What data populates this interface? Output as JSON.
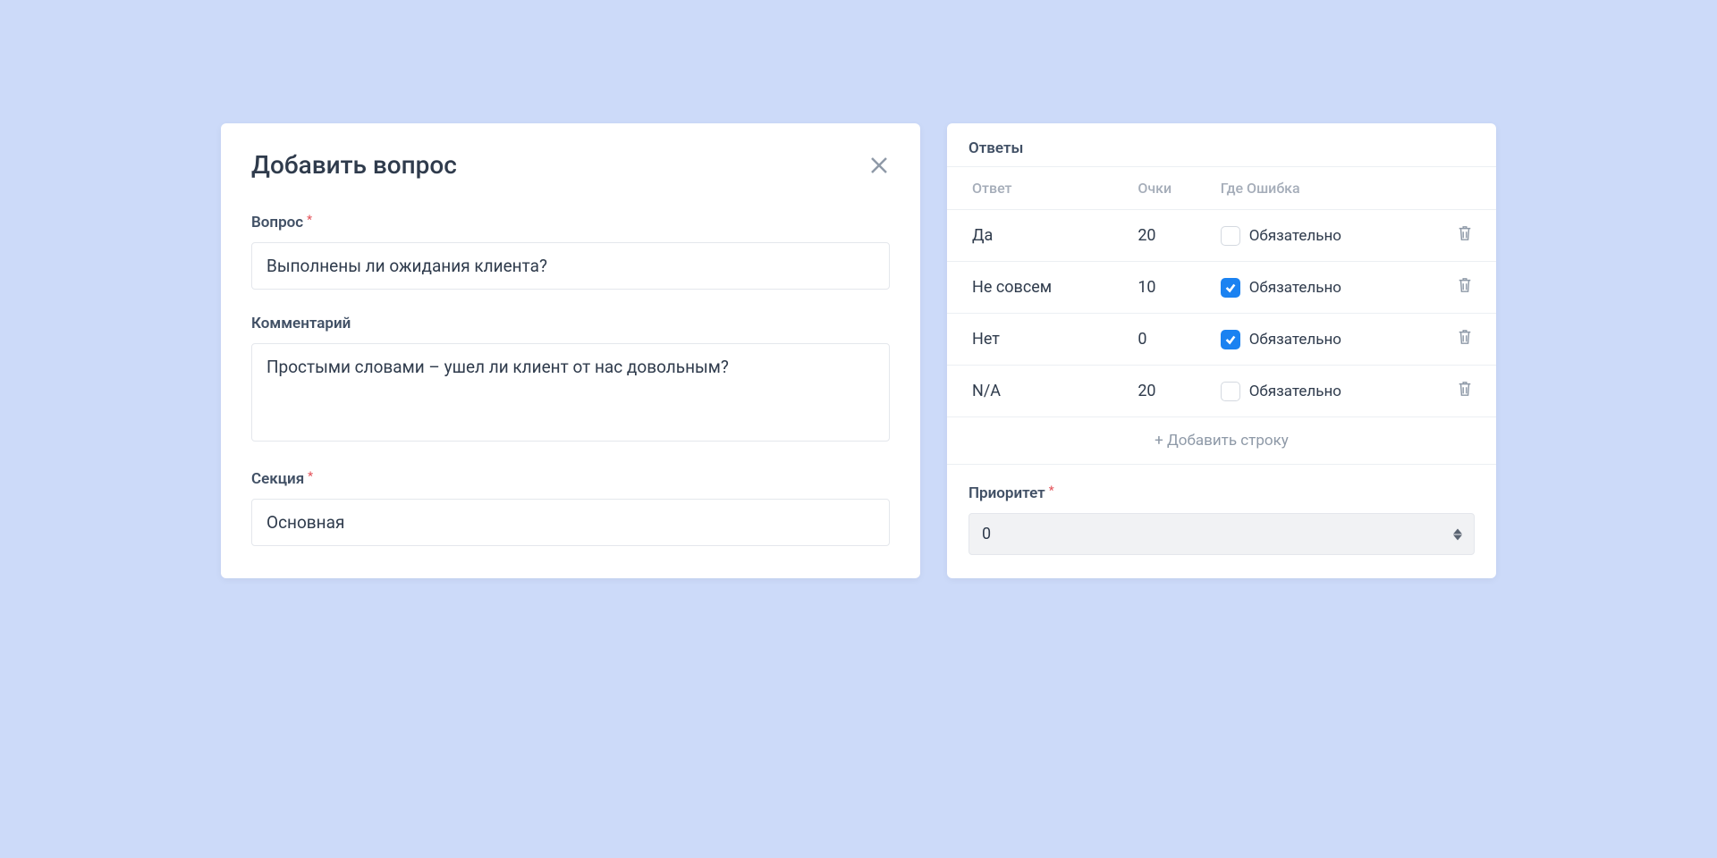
{
  "left": {
    "title": "Добавить вопрос",
    "question_label": "Вопрос",
    "question_value": "Выполнены ли ожидания клиента?",
    "comment_label": "Комментарий",
    "comment_value": "Простыми словами – ушел ли клиент от нас довольным?",
    "section_label": "Секция",
    "section_value": "Основная"
  },
  "right": {
    "answers_title": "Ответы",
    "headers": {
      "answer": "Ответ",
      "points": "Очки",
      "error": "Где Ошибка"
    },
    "oblig_label": "Обязательно",
    "rows": [
      {
        "answer": "Да",
        "points": "20",
        "checked": false
      },
      {
        "answer": "Не совсем",
        "points": "10",
        "checked": true
      },
      {
        "answer": "Нет",
        "points": "0",
        "checked": true
      },
      {
        "answer": "N/A",
        "points": "20",
        "checked": false
      }
    ],
    "add_row": "+ Добавить строку",
    "priority_label": "Приоритет",
    "priority_value": "0"
  }
}
